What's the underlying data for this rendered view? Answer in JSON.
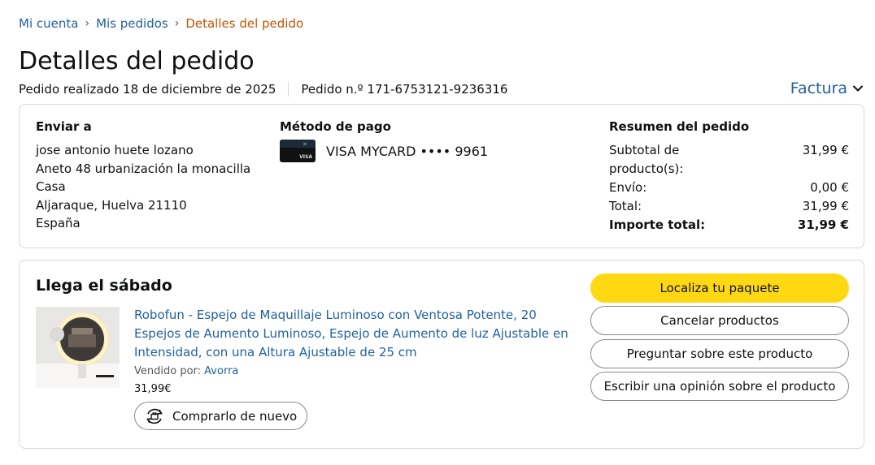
{
  "breadcrumb": {
    "items": [
      "Mi cuenta",
      "Mis pedidos"
    ],
    "current": "Detalles del pedido",
    "separator": "›"
  },
  "page": {
    "title": "Detalles del pedido",
    "order_date": "Pedido realizado 18 de diciembre de 2025",
    "order_number": "Pedido n.º 171-6753121-9236316",
    "invoice_label": "Factura"
  },
  "shipping": {
    "title": "Enviar a",
    "lines": [
      "jose antonio huete lozano",
      "Aneto 48 urbanización la monacilla",
      "Casa",
      "Aljaraque, Huelva 21110",
      "España"
    ]
  },
  "payment": {
    "title": "Método de pago",
    "card_label": "VISA MYCARD •••• 9961"
  },
  "summary": {
    "title": "Resumen del pedido",
    "rows": [
      {
        "label": "Subtotal de producto(s):",
        "value": "31,99 €"
      },
      {
        "label": "Envío:",
        "value": "0,00 €"
      },
      {
        "label": "Total:",
        "value": "31,99 €"
      },
      {
        "label": "Importe total:",
        "value": "31,99 €"
      }
    ]
  },
  "shipment": {
    "arrival": "Llega el sábado",
    "product_title": "Robofun - Espejo de Maquillaje Luminoso con Ventosa Potente, 20 Espejos de Aumento Luminoso, Espejo de Aumento de luz Ajustable en Intensidad, con una Altura Ajustable de 25 cm",
    "sold_by_label": "Vendido por:",
    "seller": "Avorra",
    "price": "31,99€",
    "buy_again": "Comprarlo de nuevo",
    "actions": [
      "Localiza tu paquete",
      "Cancelar productos",
      "Preguntar sobre este producto",
      "Escribir una opinión sobre el producto"
    ]
  },
  "colors": {
    "link": "#2162a1",
    "breadcrumb_current": "#c45500",
    "primary_button": "#ffd814",
    "border": "#d5d9d9"
  }
}
